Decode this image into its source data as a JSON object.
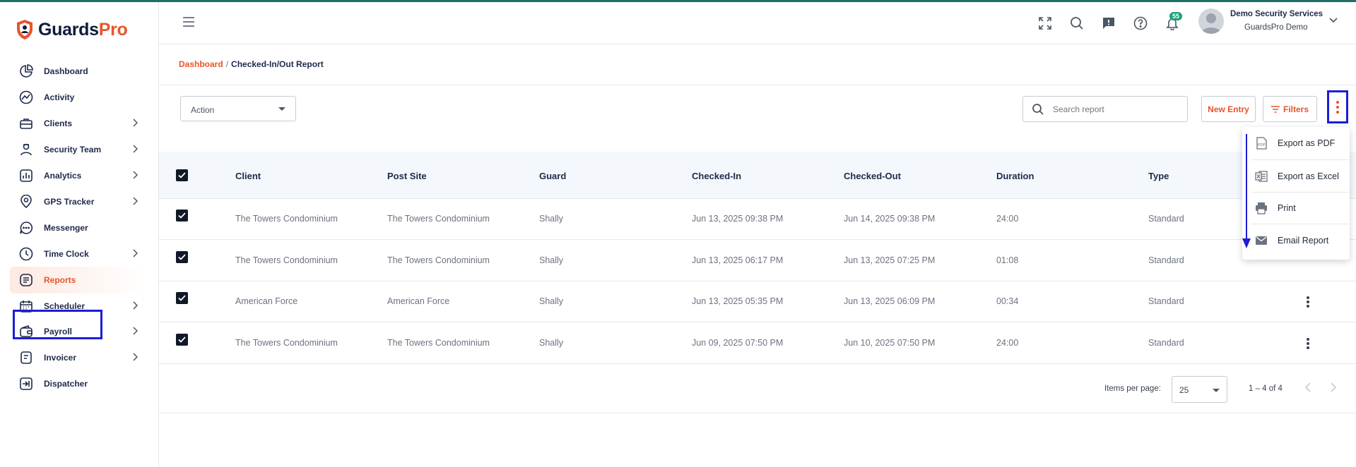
{
  "app": {
    "logo_part1": "Guards",
    "logo_part2": "Pro"
  },
  "colors": {
    "accent": "#e8552c",
    "navy": "#1e2a4a",
    "highlight": "#1d1dd6",
    "badge": "#1aa179"
  },
  "sidebar": {
    "items": [
      {
        "label": "Dashboard",
        "icon": "dashboard-icon",
        "has_submenu": false
      },
      {
        "label": "Activity",
        "icon": "activity-icon",
        "has_submenu": false
      },
      {
        "label": "Clients",
        "icon": "briefcase-icon",
        "has_submenu": true
      },
      {
        "label": "Security Team",
        "icon": "security-team-icon",
        "has_submenu": true
      },
      {
        "label": "Analytics",
        "icon": "analytics-icon",
        "has_submenu": true
      },
      {
        "label": "GPS Tracker",
        "icon": "location-pin-icon",
        "has_submenu": true
      },
      {
        "label": "Messenger",
        "icon": "chat-bubble-icon",
        "has_submenu": false
      },
      {
        "label": "Time Clock",
        "icon": "clock-icon",
        "has_submenu": true
      },
      {
        "label": "Reports",
        "icon": "reports-icon",
        "has_submenu": false,
        "active": true
      },
      {
        "label": "Scheduler",
        "icon": "calendar-icon",
        "has_submenu": true
      },
      {
        "label": "Payroll",
        "icon": "wallet-icon",
        "has_submenu": true
      },
      {
        "label": "Invoicer",
        "icon": "invoice-icon",
        "has_submenu": true
      },
      {
        "label": "Dispatcher",
        "icon": "dispatch-icon",
        "has_submenu": false
      }
    ]
  },
  "header": {
    "notification_count": "55",
    "user_name": "Demo Security Services",
    "user_org": "GuardsPro Demo"
  },
  "breadcrumb": {
    "link": "Dashboard",
    "separator": "/",
    "current": "Checked-In/Out Report"
  },
  "toolbar": {
    "action_placeholder": "Action",
    "search_placeholder": "Search report",
    "new_entry_label": "New Entry",
    "filters_label": "Filters"
  },
  "table": {
    "columns": [
      "Client",
      "Post Site",
      "Guard",
      "Checked-In",
      "Checked-Out",
      "Duration",
      "Type"
    ],
    "rows": [
      [
        "The Towers Condominium",
        "The Towers Condominium",
        "Shally",
        "Jun 13, 2025 09:38 PM",
        "Jun 14, 2025 09:38 PM",
        "24:00",
        "Standard"
      ],
      [
        "The Towers Condominium",
        "The Towers Condominium",
        "Shally",
        "Jun 13, 2025 06:17 PM",
        "Jun 13, 2025 07:25 PM",
        "01:08",
        "Standard"
      ],
      [
        "American Force",
        "American Force",
        "Shally",
        "Jun 13, 2025 05:35 PM",
        "Jun 13, 2025 06:09 PM",
        "00:34",
        "Standard"
      ],
      [
        "The Towers Condominium",
        "The Towers Condominium",
        "Shally",
        "Jun 09, 2025 07:50 PM",
        "Jun 10, 2025 07:50 PM",
        "24:00",
        "Standard"
      ]
    ]
  },
  "pagination": {
    "items_per_page_label": "Items per page:",
    "items_per_page": "25",
    "range": "1 – 4 of 4"
  },
  "export_menu": {
    "items": [
      {
        "label": "Export as PDF",
        "icon": "pdf-icon"
      },
      {
        "label": "Export as Excel",
        "icon": "excel-icon"
      },
      {
        "label": "Print",
        "icon": "printer-icon"
      },
      {
        "label": "Email Report",
        "icon": "email-icon"
      }
    ]
  }
}
